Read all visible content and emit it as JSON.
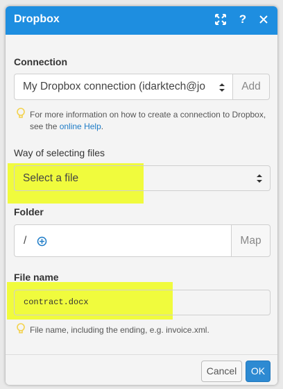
{
  "dialog": {
    "title": "Dropbox",
    "header_icons": [
      "expand-icon",
      "help-icon",
      "close-icon"
    ],
    "help_glyph": "?"
  },
  "connection": {
    "label": "Connection",
    "selected": "My Dropbox connection (idarktech@jo",
    "add_label": "Add",
    "hint_prefix": "For more information on how to create a connection to Dropbox, see the ",
    "hint_link": "online Help",
    "hint_suffix": "."
  },
  "way": {
    "label": "Way of selecting files",
    "selected": "Select a file"
  },
  "folder": {
    "label": "Folder",
    "value": "/",
    "map_label": "Map"
  },
  "filename": {
    "label": "File name",
    "value": "contract.docx",
    "hint": "File name, including the ending, e.g. invoice.xml."
  },
  "footer": {
    "cancel_label": "Cancel",
    "ok_label": "OK"
  },
  "colors": {
    "header": "#1e8ee0",
    "highlight": "#eefc1c",
    "ok_button": "#2d8ad2",
    "link": "#1e7cc7",
    "bulb": "#f3d24e"
  }
}
